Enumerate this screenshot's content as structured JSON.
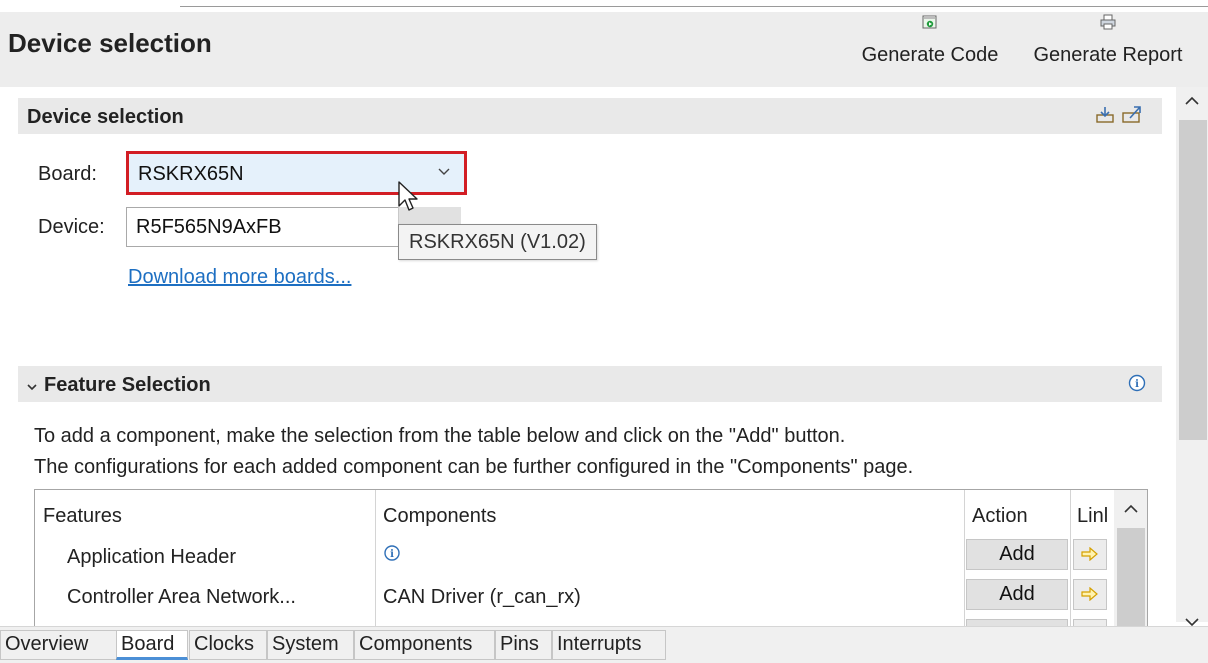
{
  "header": {
    "title": "Device selection",
    "generate_code_label": "Generate Code",
    "generate_report_label": "Generate Report",
    "generate_code_icon": "generate-code-icon",
    "generate_report_icon": "generate-report-icon"
  },
  "device_section": {
    "title": "Device selection",
    "board_label": "Board:",
    "board_value": "RSKRX65N",
    "device_label": "Device:",
    "device_value": "R5F565N9AxFB",
    "tooltip": "RSKRX65N (V1.02)",
    "download_link": "Download more boards..."
  },
  "feature_section": {
    "title": "Feature Selection",
    "desc_line1": "To add a component, make the selection from the table below and click on the \"Add\" button.",
    "desc_line2": "The configurations for each added component can be further configured in the \"Components\" page.",
    "table": {
      "headers": [
        "Features",
        "Components",
        "Action",
        "Linl"
      ],
      "rows": [
        {
          "feature": "Application Header",
          "component": "",
          "action": "Add"
        },
        {
          "feature": "Controller Area Network...",
          "component": "CAN Driver (r_can_rx)",
          "action": "Add"
        }
      ]
    }
  },
  "tabs": [
    "Overview",
    "Board",
    "Clocks",
    "System",
    "Components",
    "Pins",
    "Interrupts"
  ],
  "active_tab": "Board",
  "colors": {
    "accent": "#d21d24",
    "link": "#1d6fc2",
    "combo_bg": "#e5f1fb",
    "tab_underline": "#4b8fd6"
  }
}
